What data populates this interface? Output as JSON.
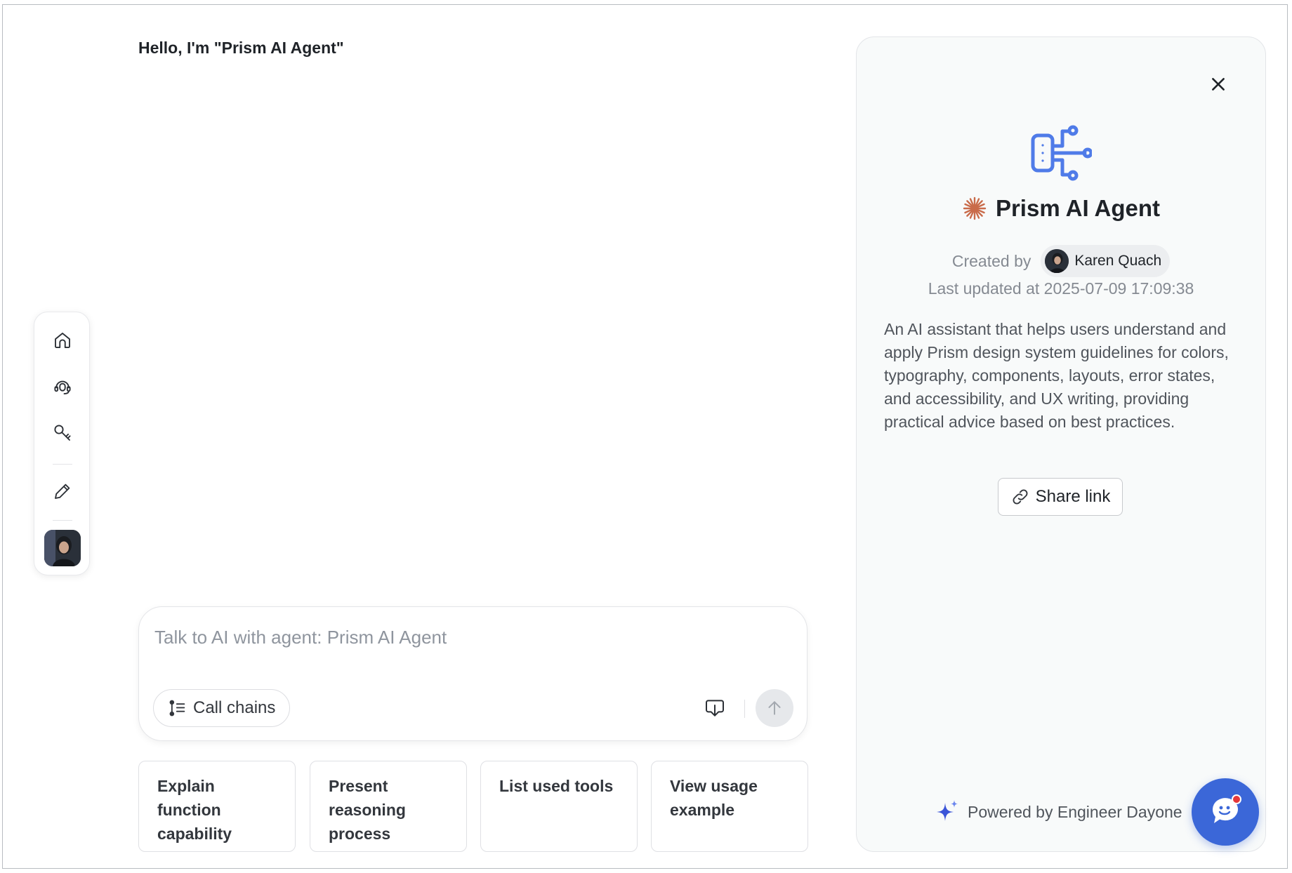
{
  "greeting": "Hello, I'm \"Prism AI Agent\"",
  "toolbar": {
    "items": [
      "home-icon",
      "support-icon",
      "key-icon",
      "pencil-icon"
    ]
  },
  "composer": {
    "placeholder": "Talk to AI with agent: Prism AI Agent",
    "call_chains_label": "Call chains"
  },
  "suggestions": [
    "Explain function capability",
    "Present reasoning process",
    "List used tools",
    "View usage example"
  ],
  "panel": {
    "agent_name": "Prism AI Agent",
    "created_by_label": "Created by",
    "author": "Karen Quach",
    "last_updated": "Last updated at 2025-07-09 17:09:38",
    "description": "An AI assistant that helps users understand and apply Prism design system guidelines for colors, typography, components, layouts, error states, and accessibility, and UX writing, providing practical advice based on best practices.",
    "share_label": "Share link",
    "powered_by": "Powered by Engineer Dayone"
  },
  "colors": {
    "accent_blue": "#3b67d8",
    "agent_icon_blue": "#4f7be8",
    "sparkle_orange": "#c96b4a",
    "notification_red": "#e5383b"
  }
}
